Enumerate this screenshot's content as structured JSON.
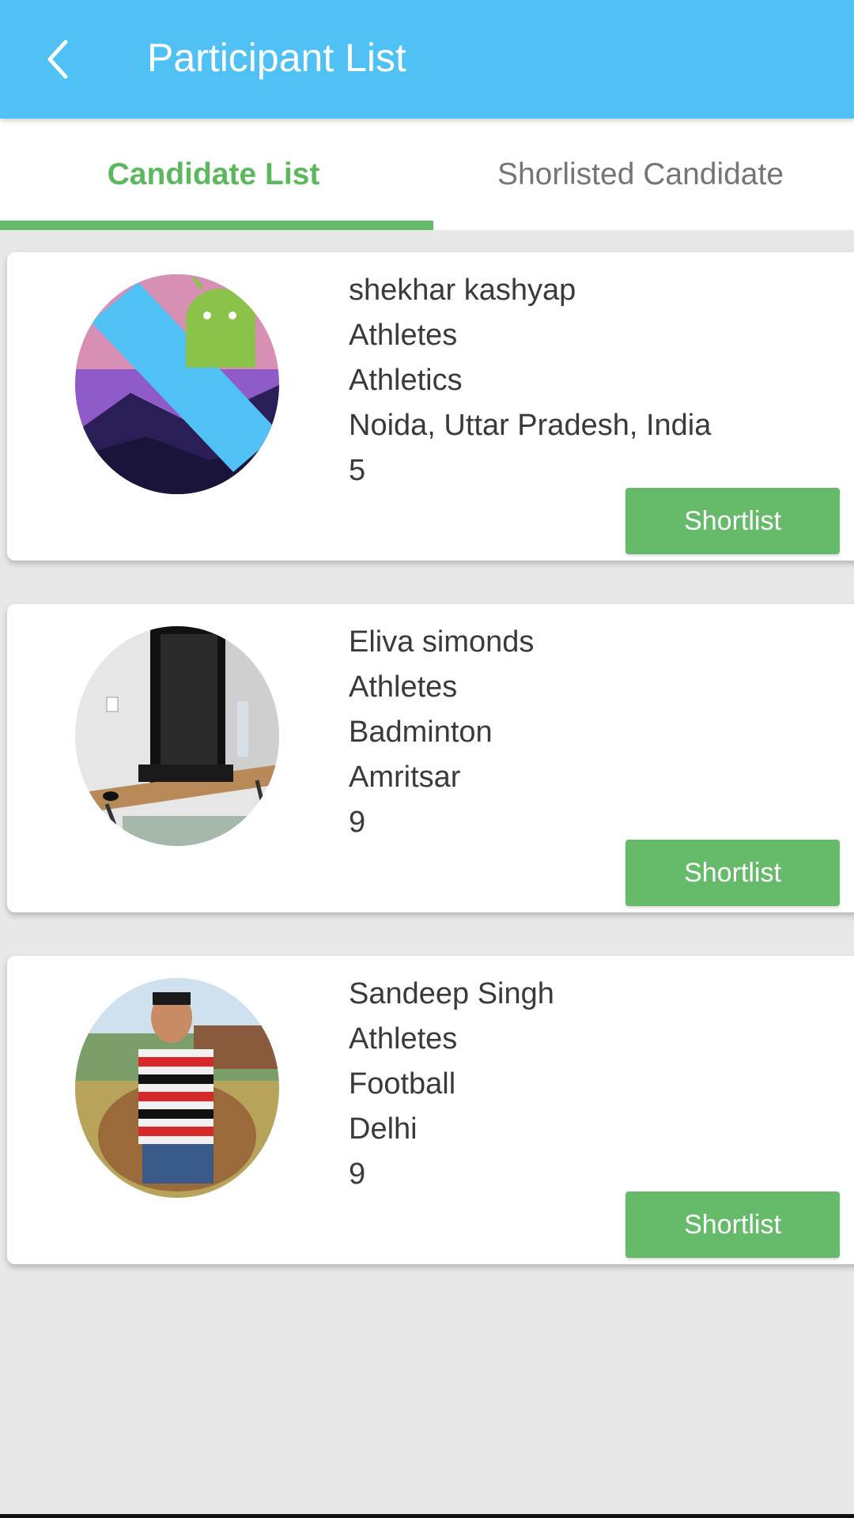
{
  "appbar": {
    "title": "Participant List",
    "back_icon": "chevron-left-icon",
    "color": "#4fc1f5"
  },
  "tabs": [
    {
      "label": "Candidate List",
      "active": true
    },
    {
      "label": "Shorlisted Candidate",
      "active": false
    }
  ],
  "accent_color": "#66bb6a",
  "candidates": [
    {
      "name": "shekhar kashyap",
      "category": "Athletes",
      "sport": "Athletics",
      "location": "Noida, Uttar Pradesh, India",
      "number": "5",
      "button_label": "Shortlist"
    },
    {
      "name": "Eliva simonds",
      "category": "Athletes",
      "sport": "Badminton",
      "location": "Amritsar",
      "number": "9",
      "button_label": "Shortlist"
    },
    {
      "name": "Sandeep Singh",
      "category": "Athletes",
      "sport": "Football",
      "location": "Delhi",
      "number": "9",
      "button_label": "Shortlist"
    }
  ]
}
